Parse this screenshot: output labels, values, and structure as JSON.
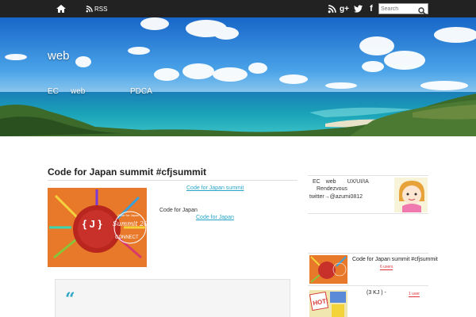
{
  "topbar": {
    "rss_label": "RSS",
    "social_icons": [
      "rss-icon",
      "google-plus-icon",
      "twitter-icon",
      "facebook-icon"
    ],
    "search_placeholder": "Search"
  },
  "hero": {
    "site_title": "web",
    "tagline": [
      "EC",
      "web",
      "PDCA"
    ]
  },
  "post": {
    "title": "Code for Japan summit #cfjsummit",
    "meta_line1_link_a": "",
    "meta_line1_link_b": "Code for Japan summit",
    "meta_line2_text": "Code for Japan",
    "meta_line3_link": "Code for Japan",
    "thumbnail_text_1": "{ J }",
    "thumbnail_text_2": "Code for Japan",
    "thumbnail_text_3": "Summit 20",
    "thumbnail_text_4": "CONNECT",
    "quote_mark": "“"
  },
  "sidebar": {
    "profile_line1": "EC　web　　UX/UI/IA",
    "profile_line2": "Rendezvous",
    "profile_line3": "twitter→@azumi0812",
    "popular": [
      {
        "title": "Code for Japan summit #cfjsummit",
        "badge": "6 users"
      },
      {
        "title": "(3 KJ ) -",
        "badge": "1 user"
      }
    ],
    "hot_label": "HOT!"
  },
  "colors": {
    "topbar": "#222222",
    "link": "#27a5c8",
    "badge": "#e0303a",
    "sky": "#1f7fd6",
    "sea": "#1aa3b8"
  }
}
